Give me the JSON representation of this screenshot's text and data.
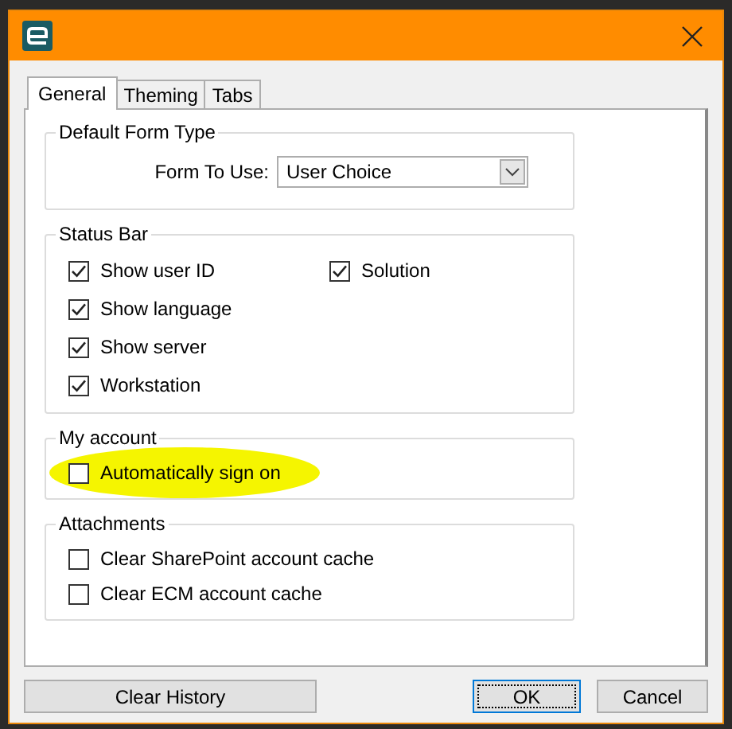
{
  "tabs": [
    {
      "label": "General",
      "selected": true
    },
    {
      "label": "Theming",
      "selected": false
    },
    {
      "label": "Tabs",
      "selected": false
    }
  ],
  "groups": [
    {
      "title": "Default Form Type",
      "kind": "dropdown",
      "label": "Form To Use:",
      "value": "User Choice"
    },
    {
      "title": "Status Bar",
      "kind": "checkboxes",
      "items": [
        {
          "label": "Show user ID",
          "checked": true,
          "highlighted": false
        },
        {
          "label": "Show language",
          "checked": true,
          "highlighted": false
        },
        {
          "label": "Show server",
          "checked": true,
          "highlighted": false
        },
        {
          "label": "Workstation",
          "checked": true,
          "highlighted": false
        },
        {
          "label": "Solution",
          "checked": true,
          "highlighted": false
        }
      ]
    },
    {
      "title": "My account",
      "kind": "checkboxes",
      "items": [
        {
          "label": "Automatically sign on",
          "checked": false,
          "highlighted": true
        }
      ]
    },
    {
      "title": "Attachments",
      "kind": "checkboxes",
      "items": [
        {
          "label": "Clear SharePoint account cache",
          "checked": false,
          "highlighted": false
        },
        {
          "label": "Clear ECM account cache",
          "checked": false,
          "highlighted": false
        }
      ]
    }
  ],
  "buttons": [
    {
      "label": "Clear History",
      "kind": "left"
    },
    {
      "label": "OK",
      "kind": "default"
    },
    {
      "label": "Cancel",
      "kind": "normal"
    }
  ]
}
